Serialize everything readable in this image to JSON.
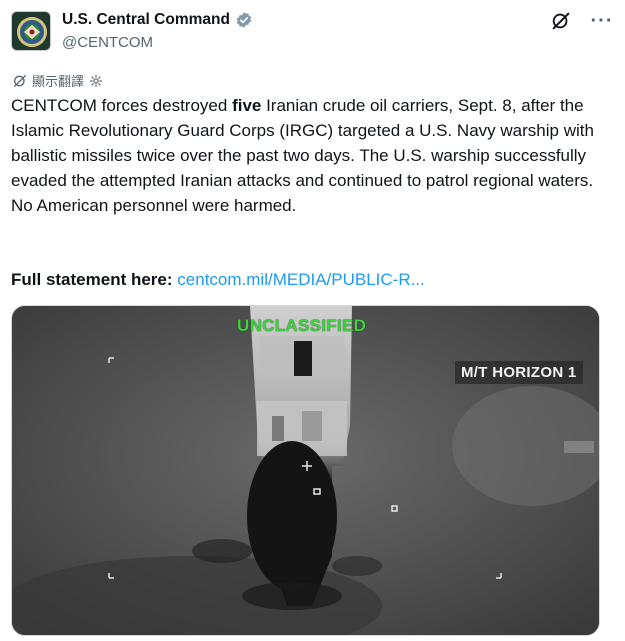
{
  "account": {
    "display_name": "U.S. Central Command",
    "handle": "@CENTCOM",
    "verified": true
  },
  "icons": {
    "avatar": "centcom-seal",
    "verified": "verified-badge-icon",
    "grok": "grok-icon",
    "more": "more-icon",
    "translate": "translate-icon",
    "settings": "gear-icon"
  },
  "translate": {
    "label": "顯示翻譯"
  },
  "tweet": {
    "part1": "CENTCOM forces destroyed ",
    "bold": "five",
    "part2": " Iranian crude oil carriers, Sept. 8, after the Islamic Revolutionary Guard Corps (IRGC) targeted a U.S. Navy warship with ballistic missiles twice over the past two days. The U.S. warship successfully evaded the attempted Iranian attacks and continued to patrol regional waters. No American personnel were harmed.",
    "statement_label": "Full statement here:",
    "statement_link": "centcom.mil/MEDIA/PUBLIC-R..."
  },
  "media": {
    "overlay_top": "UNCLASSIFIED",
    "overlay_ship": "M/T HORIZON 1"
  },
  "colors": {
    "link": "#1d9bf0",
    "unclassified_green": "#3ed43e",
    "verified_blue": "#829aab",
    "text": "#0f1419",
    "muted": "#536471"
  }
}
